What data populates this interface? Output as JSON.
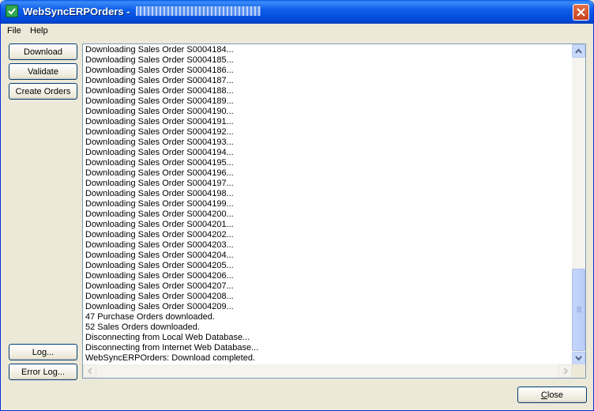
{
  "window": {
    "title": "WebSyncERPOrders",
    "title_separator": "-",
    "colors": {
      "titlebar": "#0054e3",
      "face": "#ece9d8",
      "close": "#d7542e"
    }
  },
  "menu": [
    "File",
    "Help"
  ],
  "side_buttons": {
    "download": "Download",
    "validate": "Validate",
    "create_orders": "Create Orders",
    "log": "Log...",
    "error_log": "Error Log..."
  },
  "close_button": {
    "prefix": "",
    "accel": "C",
    "rest": "lose"
  },
  "log_lines": [
    "Downloading Sales Order S0004184...",
    "Downloading Sales Order S0004185...",
    "Downloading Sales Order S0004186...",
    "Downloading Sales Order S0004187...",
    "Downloading Sales Order S0004188...",
    "Downloading Sales Order S0004189...",
    "Downloading Sales Order S0004190...",
    "Downloading Sales Order S0004191...",
    "Downloading Sales Order S0004192...",
    "Downloading Sales Order S0004193...",
    "Downloading Sales Order S0004194...",
    "Downloading Sales Order S0004195...",
    "Downloading Sales Order S0004196...",
    "Downloading Sales Order S0004197...",
    "Downloading Sales Order S0004198...",
    "Downloading Sales Order S0004199...",
    "Downloading Sales Order S0004200...",
    "Downloading Sales Order S0004201...",
    "Downloading Sales Order S0004202...",
    "Downloading Sales Order S0004203...",
    "Downloading Sales Order S0004204...",
    "Downloading Sales Order S0004205...",
    "Downloading Sales Order S0004206...",
    "Downloading Sales Order S0004207...",
    "Downloading Sales Order S0004208...",
    "Downloading Sales Order S0004209...",
    "47 Purchase Orders downloaded.",
    "52 Sales Orders downloaded.",
    "Disconnecting from Local Web Database...",
    "Disconnecting from Internet Web Database...",
    "WebSyncERPOrders: Download completed."
  ],
  "icons": {
    "app": "check-shield-icon",
    "close": "close-x-icon",
    "scroll_up": "arrow-up-icon",
    "scroll_down": "arrow-down-icon",
    "scroll_left": "arrow-left-icon",
    "scroll_right": "arrow-right-icon"
  }
}
